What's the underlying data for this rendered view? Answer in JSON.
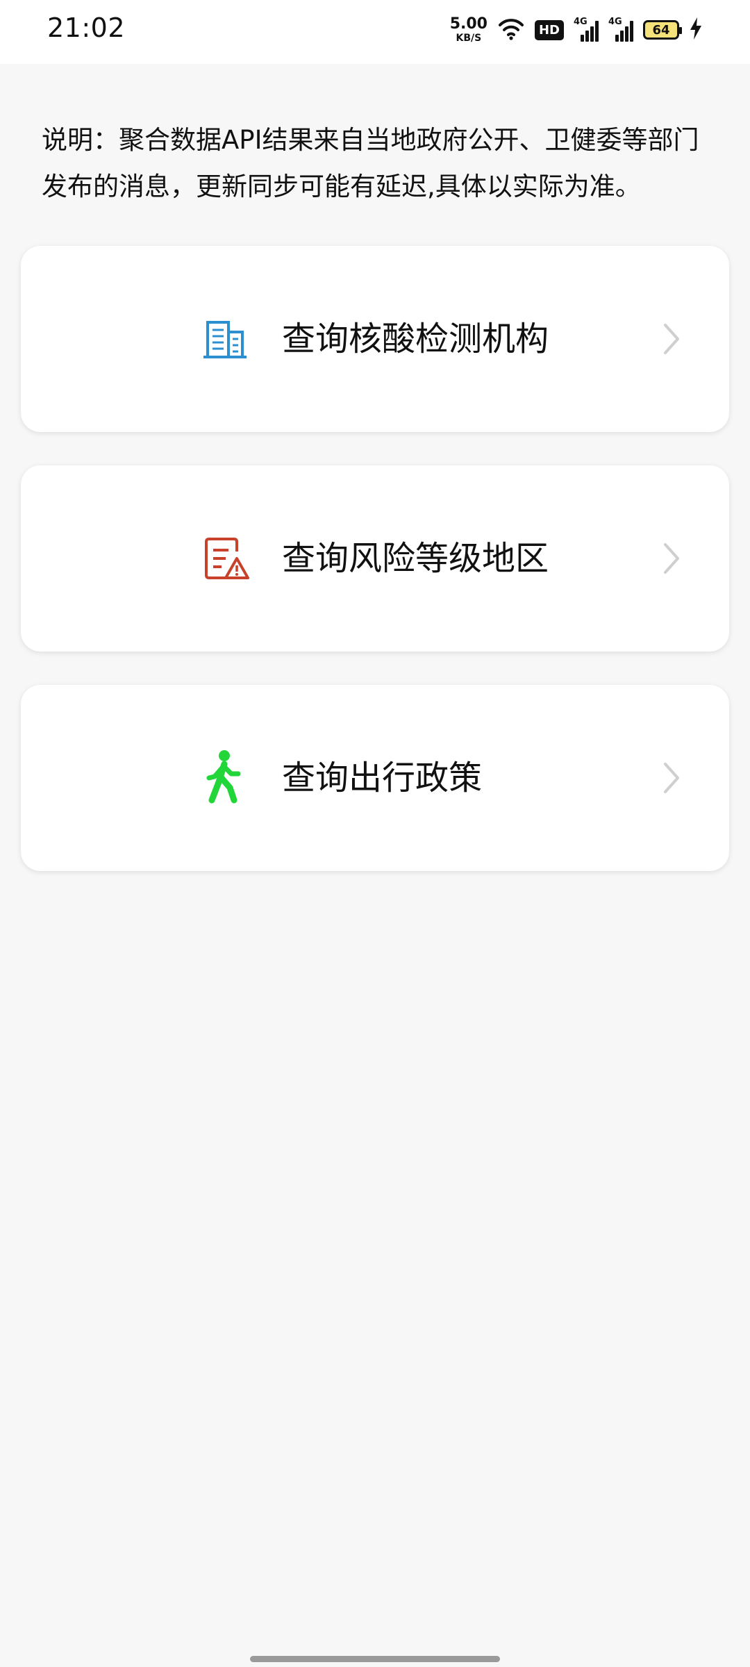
{
  "status_bar": {
    "time": "21:02",
    "net_speed_value": "5.00",
    "net_speed_unit": "KB/S",
    "hd_label": "HD",
    "sim1_label": "4G",
    "sim2_label": "4G",
    "battery_level": "64",
    "icons": [
      "wifi-icon",
      "hd-icon",
      "signal-icon",
      "signal-icon",
      "battery-icon",
      "charging-icon"
    ]
  },
  "note": {
    "text": "说明：聚合数据API结果来自当地政府公开、卫健委等部门发布的消息，更新同步可能有延迟,具体以实际为准。"
  },
  "menu": {
    "items": [
      {
        "label": "查询核酸检测机构",
        "icon": "building-icon",
        "icon_color": "#2b8fd0"
      },
      {
        "label": "查询风险等级地区",
        "icon": "risk-document-icon",
        "icon_color": "#c8412a"
      },
      {
        "label": "查询出行政策",
        "icon": "walking-person-icon",
        "icon_color": "#22d63a"
      }
    ],
    "chevron_color": "#cfcfcf"
  }
}
